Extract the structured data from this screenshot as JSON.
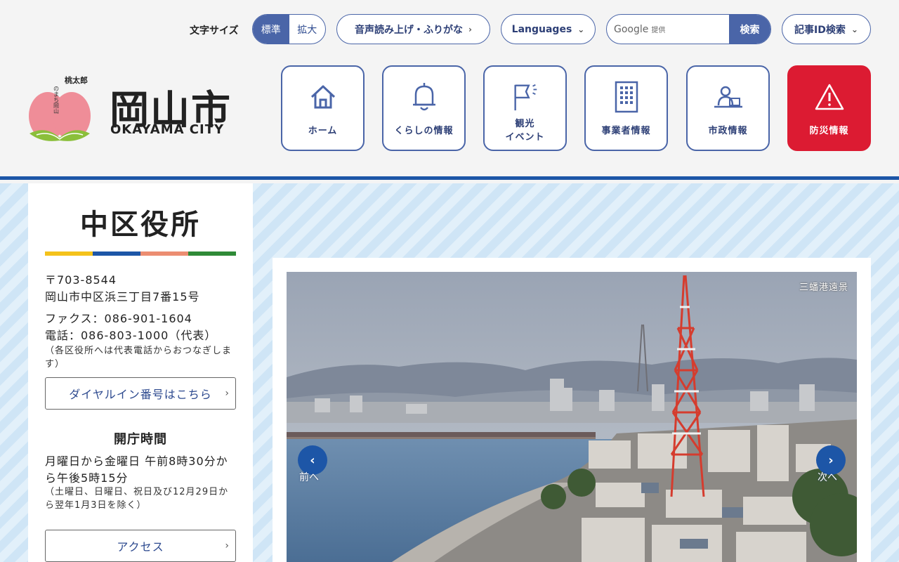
{
  "header": {
    "font_size_label": "文字サイズ",
    "font_size_options": [
      "標準",
      "拡大"
    ],
    "voice_button": "音声読み上げ・ふりがな",
    "languages_button": "Languages",
    "search": {
      "google_label": "Google",
      "provided_label": "提供",
      "button_label": "検索"
    },
    "article_id_button": "記事ID検索"
  },
  "logo": {
    "mascot_name": "桃太郎",
    "mascot_sub": "のまち岡山",
    "title": "岡山市",
    "subtitle": "OKAYAMA CITY"
  },
  "nav": [
    {
      "label": "ホーム",
      "icon": "home-icon"
    },
    {
      "label": "くらしの情報",
      "icon": "bell-icon"
    },
    {
      "label": "観光",
      "label2": "イベント",
      "icon": "flag-icon"
    },
    {
      "label": "事業者情報",
      "icon": "building-icon"
    },
    {
      "label": "市政情報",
      "icon": "city-hall-icon"
    },
    {
      "label": "防災情報",
      "icon": "warning-icon"
    }
  ],
  "sidebar": {
    "title": "中区役所",
    "stripe_colors": [
      "#f4c21b",
      "#1d56a7",
      "#ec8d71",
      "#2f8a37"
    ],
    "postal": "〒703-8544",
    "address": "岡山市中区浜三丁目7番15号",
    "fax": "ファクス：086-901-1604",
    "phone": "電話：086-803-1000（代表）",
    "phone_note": "（各区役所へは代表電話からおつなぎします）",
    "dialin_button": "ダイヤルイン番号はこちら",
    "hours_heading": "開庁時間",
    "hours": "月曜日から金曜日 午前8時30分から午後5時15分",
    "hours_note": "（土曜日、日曜日、祝日及び12月29日から翌年1月3日を除く）",
    "access_button": "アクセス"
  },
  "carousel": {
    "caption": "三蟠港遠景",
    "prev_label": "前へ",
    "next_label": "次へ"
  }
}
